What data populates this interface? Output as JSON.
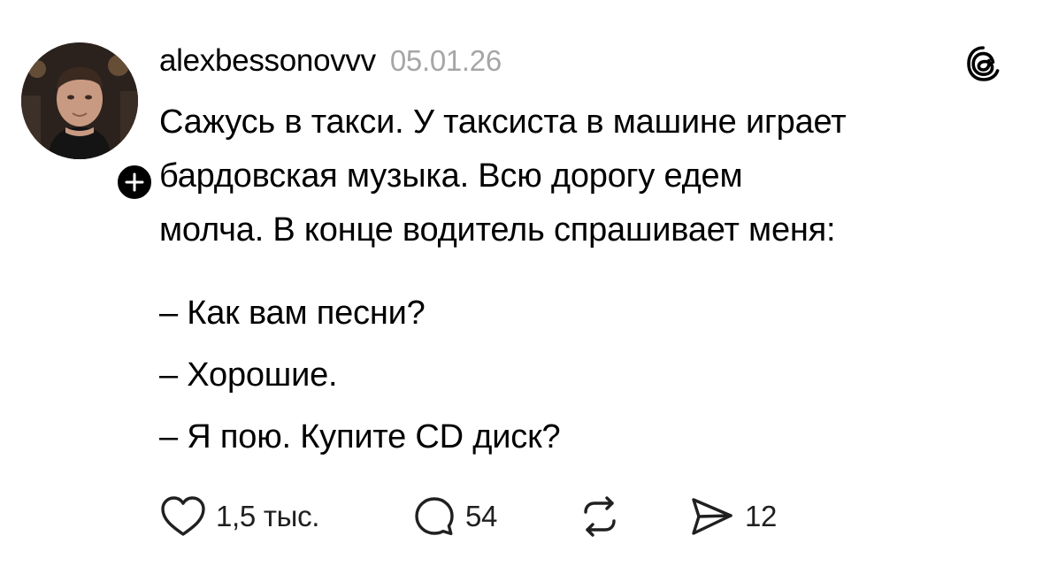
{
  "post": {
    "username": "alexbessonovvv",
    "date": "05.01.26",
    "text": {
      "paragraph": [
        "Сажусь в такси. У таксиста в машине играет",
        "бардовская музыка. Всю дорогу едем",
        "молча. В конце водитель спрашивает меня:"
      ],
      "dialog": [
        "– Как вам песни?",
        "– Хорошие.",
        "– Я пою. Купите CD диск?"
      ]
    },
    "actions": {
      "like_count": "1,5 тыс.",
      "comment_count": "54",
      "share_count": "12"
    }
  },
  "icons": {
    "avatar": "user-photo",
    "follow": "plus-icon",
    "app_logo": "threads-logo-icon",
    "like": "heart-icon",
    "comment": "comment-bubble-icon",
    "repost": "repost-icon",
    "share": "send-icon"
  },
  "colors": {
    "text": "#000000",
    "muted": "#a6a6a6",
    "background": "#ffffff"
  }
}
